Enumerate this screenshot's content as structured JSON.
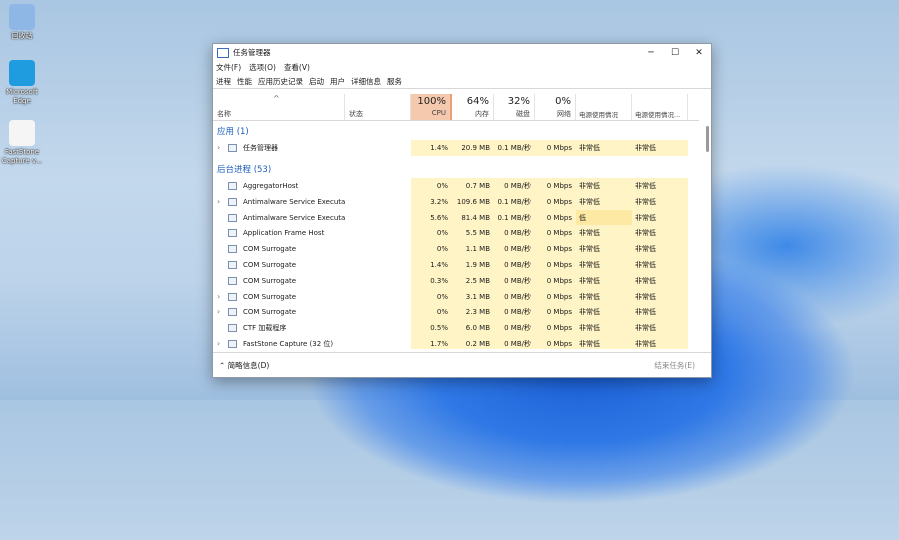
{
  "desktop": {
    "icons": [
      {
        "label": "回收站",
        "color": "#8fb7e6"
      },
      {
        "label": "Microsoft\nEdge",
        "color": "#1f9be0"
      },
      {
        "label": "FastStone\nCapture v...",
        "color": "#f5f5f5"
      }
    ]
  },
  "window": {
    "title": "任务管理器",
    "controls": {
      "minimize": "─",
      "maximize": "☐",
      "close": "✕"
    },
    "menu": [
      "文件(F)",
      "选项(O)",
      "查看(V)"
    ],
    "tabs": [
      "进程",
      "性能",
      "应用历史记录",
      "启动",
      "用户",
      "详细信息",
      "服务"
    ],
    "columns": {
      "name": "名称",
      "status": "状态",
      "cpu_pct": "100%",
      "cpu": "CPU",
      "mem_pct": "64%",
      "mem": "内存",
      "disk_pct": "32%",
      "disk": "磁盘",
      "net_pct": "0%",
      "net": "网络",
      "power": "电源使用情况",
      "power_trend": "电源使用情况..."
    },
    "groups": {
      "apps": "应用 (1)",
      "background": "后台进程 (53)"
    },
    "app_rows": [
      {
        "name": "任务管理器",
        "expandable": true,
        "cpu": "1.4%",
        "mem": "20.9 MB",
        "disk": "0.1 MB/秒",
        "net": "0 Mbps",
        "power": "非常低",
        "trend": "非常低"
      }
    ],
    "bg_rows": [
      {
        "name": "AggregatorHost",
        "expandable": false,
        "cpu": "0%",
        "mem": "0.7 MB",
        "disk": "0 MB/秒",
        "net": "0 Mbps",
        "power": "非常低",
        "trend": "非常低"
      },
      {
        "name": "Antimalware Service Executa...",
        "expandable": true,
        "cpu": "3.2%",
        "mem": "109.6 MB",
        "disk": "0.1 MB/秒",
        "net": "0 Mbps",
        "power": "非常低",
        "trend": "非常低"
      },
      {
        "name": "Antimalware Service Executa...",
        "expandable": false,
        "cpu": "5.6%",
        "mem": "81.4 MB",
        "disk": "0.1 MB/秒",
        "net": "0 Mbps",
        "power": "低",
        "trend": "非常低"
      },
      {
        "name": "Application Frame Host",
        "expandable": false,
        "cpu": "0%",
        "mem": "5.5 MB",
        "disk": "0 MB/秒",
        "net": "0 Mbps",
        "power": "非常低",
        "trend": "非常低"
      },
      {
        "name": "COM Surrogate",
        "expandable": false,
        "cpu": "0%",
        "mem": "1.1 MB",
        "disk": "0 MB/秒",
        "net": "0 Mbps",
        "power": "非常低",
        "trend": "非常低"
      },
      {
        "name": "COM Surrogate",
        "expandable": false,
        "cpu": "1.4%",
        "mem": "1.9 MB",
        "disk": "0 MB/秒",
        "net": "0 Mbps",
        "power": "非常低",
        "trend": "非常低"
      },
      {
        "name": "COM Surrogate",
        "expandable": false,
        "cpu": "0.3%",
        "mem": "2.5 MB",
        "disk": "0 MB/秒",
        "net": "0 Mbps",
        "power": "非常低",
        "trend": "非常低"
      },
      {
        "name": "COM Surrogate",
        "expandable": true,
        "cpu": "0%",
        "mem": "3.1 MB",
        "disk": "0 MB/秒",
        "net": "0 Mbps",
        "power": "非常低",
        "trend": "非常低"
      },
      {
        "name": "COM Surrogate",
        "expandable": true,
        "cpu": "0%",
        "mem": "2.3 MB",
        "disk": "0 MB/秒",
        "net": "0 Mbps",
        "power": "非常低",
        "trend": "非常低"
      },
      {
        "name": "CTF 加载程序",
        "expandable": false,
        "cpu": "0.5%",
        "mem": "6.0 MB",
        "disk": "0 MB/秒",
        "net": "0 Mbps",
        "power": "非常低",
        "trend": "非常低"
      },
      {
        "name": "FastStone Capture (32 位)",
        "expandable": true,
        "cpu": "1.7%",
        "mem": "0.2 MB",
        "disk": "0 MB/秒",
        "net": "0 Mbps",
        "power": "非常低",
        "trend": "非常低"
      }
    ],
    "footer": {
      "fewer": "简略信息(D)",
      "end_task": "结束任务(E)"
    }
  }
}
